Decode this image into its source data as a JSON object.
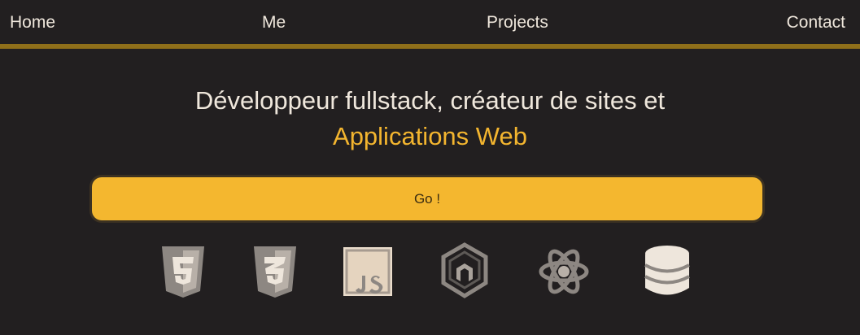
{
  "nav": {
    "items": [
      "Home",
      "Me",
      "Projects",
      "Contact"
    ]
  },
  "hero": {
    "line1": "Développeur fullstack, créateur de sites et",
    "line2": "Applications Web"
  },
  "cta": {
    "label": "Go !"
  },
  "tech_icons": [
    {
      "name": "html5-icon"
    },
    {
      "name": "css3-icon"
    },
    {
      "name": "javascript-icon"
    },
    {
      "name": "nodejs-icon"
    },
    {
      "name": "react-icon"
    },
    {
      "name": "database-icon"
    }
  ],
  "colors": {
    "background": "#221f20",
    "accent": "#f4b72f",
    "text": "#efe7dc",
    "rule": "#8f6f1a"
  }
}
